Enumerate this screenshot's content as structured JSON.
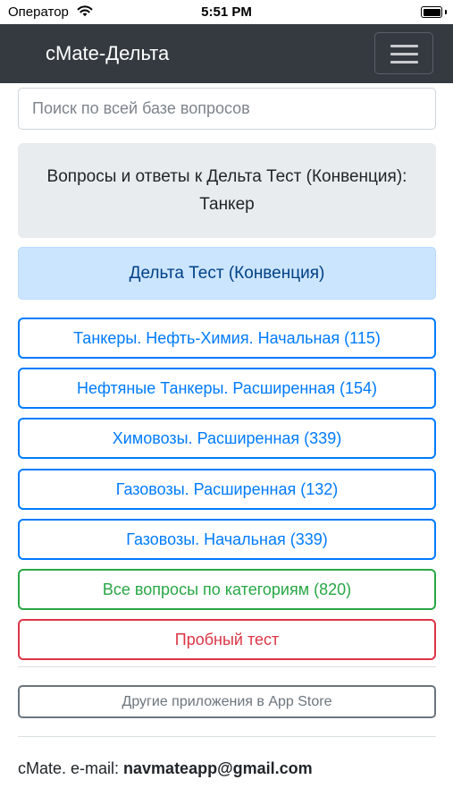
{
  "status_bar": {
    "carrier": "Оператор",
    "time": "5:51 PM"
  },
  "navbar": {
    "brand": "cMate-Дельта"
  },
  "search": {
    "placeholder": "Поиск по всей базе вопросов"
  },
  "heading": {
    "line1": "Вопросы и ответы к Дельта Тест (Конвенция):",
    "line2": "Танкер"
  },
  "section_title": "Дельта Тест (Конвенция)",
  "categories": [
    {
      "label": "Танкеры. Нефть-Химия. Начальная (115)"
    },
    {
      "label": "Нефтяные Танкеры. Расширенная (154)"
    },
    {
      "label": "Химовозы. Расширенная (339)"
    },
    {
      "label": "Газовозы. Расширенная (132)"
    },
    {
      "label": "Газовозы. Начальная (339)"
    }
  ],
  "all_questions": "Все вопросы по категориям (820)",
  "trial_test": "Пробный тест",
  "other_apps": "Другие приложения в App Store",
  "footer": {
    "label": "cMate. e-mail: ",
    "email": "navmateapp@gmail.com"
  },
  "colors": {
    "primary": "#007bff",
    "success": "#28a745",
    "danger": "#dc3545",
    "navbar": "#343a40"
  }
}
